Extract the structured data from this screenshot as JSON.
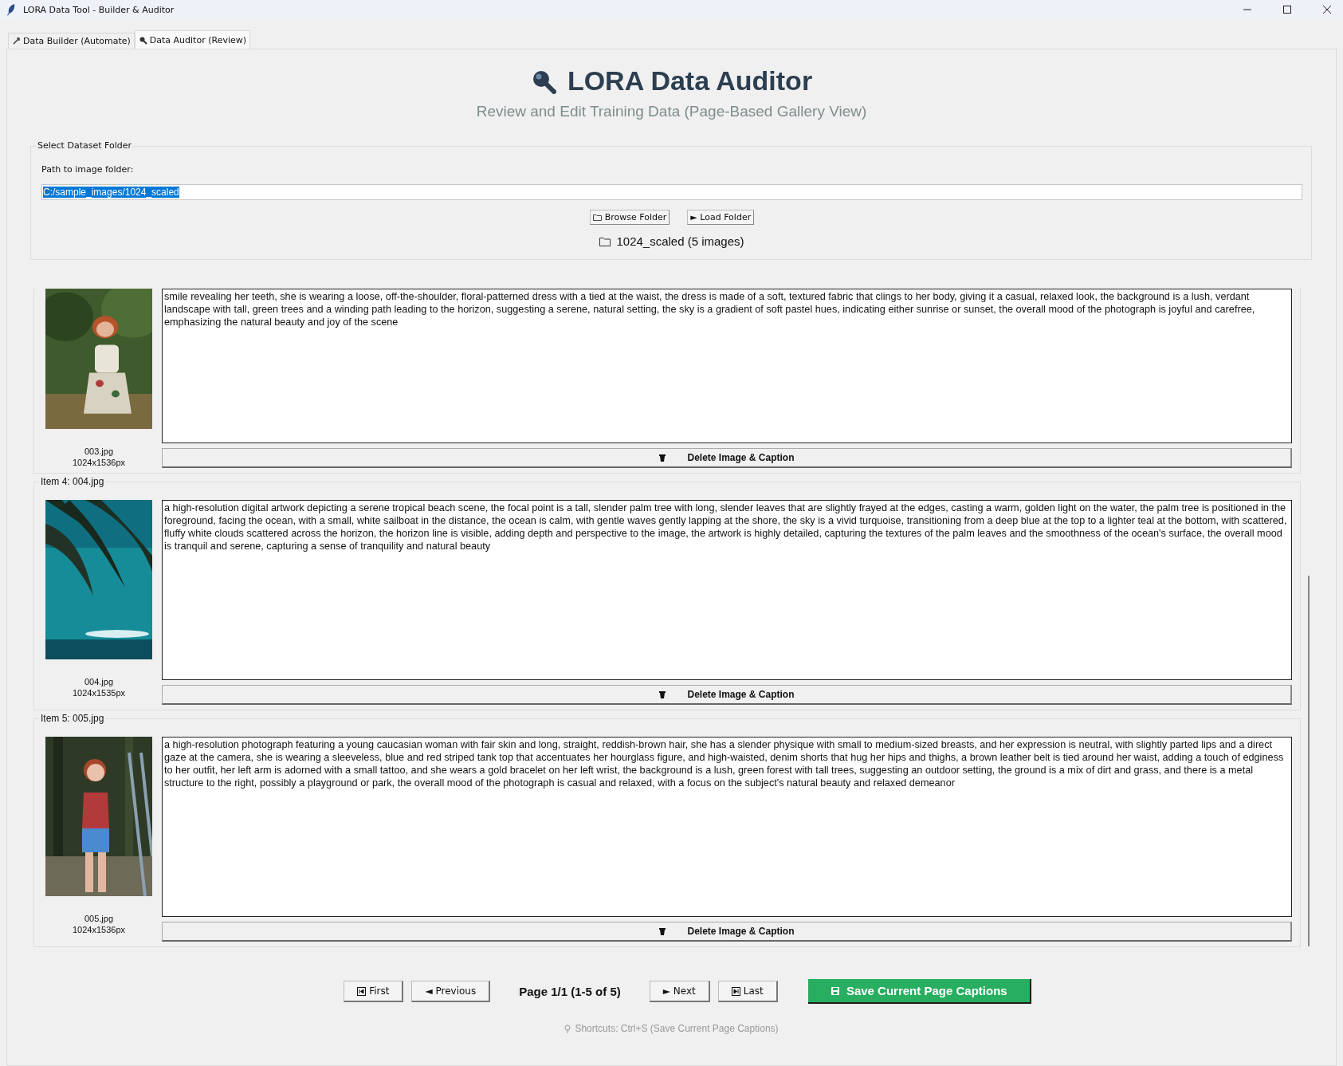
{
  "window": {
    "title": "LORA Data Tool - Builder & Auditor"
  },
  "tabs": [
    {
      "label": "Data Builder (Automate)",
      "selected": false
    },
    {
      "label": "Data Auditor (Review)",
      "selected": true
    }
  ],
  "header": {
    "title": "LORA Data Auditor",
    "subtitle": "Review and Edit Training Data (Page-Based Gallery View)"
  },
  "folder_panel": {
    "legend": "Select Dataset Folder",
    "path_label": "Path to image folder:",
    "path": {
      "value": "C:/sample_images/1024_scaled",
      "text_selected": true
    },
    "buttons": [
      {
        "label": "Browse Folder",
        "kind": "browse"
      },
      {
        "label": "► Load Folder",
        "kind": "plain"
      }
    ],
    "status": "1024_scaled (5 images)"
  },
  "items": [
    {
      "filename": "003.jpg",
      "size": "1024x1536px",
      "caption": "smile revealing her teeth, she is wearing a loose, off-the-shoulder, floral-patterned dress with a tied at the waist, the dress is made of a soft, textured fabric that clings to her body, giving it a casual, relaxed look, the background is a lush, verdant landscape with tall, green trees and a winding path leading to the horizon, suggesting a serene, natural setting, the sky is a gradient of soft pastel hues, indicating either sunrise or sunset, the overall mood of the photograph is joyful and carefree, emphasizing the natural beauty and joy of the scene",
      "delete_label": "Delete Image & Caption"
    },
    {
      "legend": "Item 4: 004.jpg",
      "filename": "004.jpg",
      "size": "1024x1535px",
      "caption": "a high-resolution digital artwork depicting a serene tropical beach scene, the focal point is a tall, slender palm tree with long, slender leaves that are slightly frayed at the edges, casting a warm, golden light on the water, the palm tree is positioned in the foreground, facing the ocean, with a small, white sailboat in the distance, the ocean is calm, with gentle waves gently lapping at the shore, the sky is a vivid turquoise, transitioning from a deep blue at the top to a lighter teal at the bottom, with scattered, fluffy white clouds scattered across the horizon, the horizon line is visible, adding depth and perspective to the image, the artwork is highly detailed, capturing the textures of the palm leaves and the smoothness of the ocean's surface, the overall mood is tranquil and serene, capturing a sense of tranquility and natural beauty",
      "delete_label": "Delete Image & Caption"
    },
    {
      "legend": "Item 5: 005.jpg",
      "filename": "005.jpg",
      "size": "1024x1536px",
      "caption": "a high-resolution photograph featuring a young caucasian woman with fair skin and long, straight, reddish-brown hair, she has a slender physique with small to medium-sized breasts, and her expression is neutral, with slightly parted lips and a direct gaze at the camera, she is wearing a sleeveless, blue and red striped tank top that accentuates her hourglass figure, and high-waisted, denim shorts that hug her hips and thighs, a brown leather belt is tied around her waist, adding a touch of edginess to her outfit, her left arm is adorned with a small tattoo, and she wears a gold bracelet on her left wrist, the background is a lush, green forest with tall trees, suggesting an outdoor setting, the ground is a mix of dirt and grass, and there is a metal structure to the right, possibly a playground or park, the overall mood of the photograph is casual and relaxed, with a focus on the subject's natural beauty and relaxed demeanor",
      "delete_label": "Delete Image & Caption"
    }
  ],
  "pagination": {
    "buttons": [
      {
        "label": "First",
        "kind": "first"
      },
      {
        "label": "◄ Previous",
        "kind": "plain"
      }
    ],
    "page_info": "Page 1/1 (1-5 of 5)",
    "buttons_after": [
      {
        "label": "► Next",
        "kind": "plain"
      },
      {
        "label": "Last",
        "kind": "last"
      }
    ],
    "save_label": "Save Current Page Captions"
  },
  "shortcuts": "Shortcuts: Ctrl+S (Save Current Page Captions)"
}
